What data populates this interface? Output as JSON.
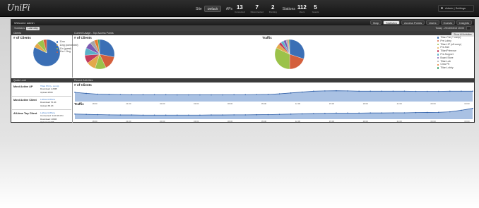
{
  "app": {
    "logo": "UniFi"
  },
  "topbar": {
    "site_label": "Site",
    "site_value": "Default",
    "counts": [
      {
        "label": "APs",
        "value": "13",
        "sub": "Connected"
      },
      {
        "label": "",
        "value": "7",
        "sub": "Disconnected"
      },
      {
        "label": "",
        "value": "2",
        "sub": "Pending"
      },
      {
        "label": "Stations",
        "value": "112",
        "sub": "Users"
      },
      {
        "label": "",
        "value": "5",
        "sub": "Guests"
      }
    ],
    "admin": "Admin | Settings"
  },
  "panel": {
    "title": "Welcome admin",
    "tabs": [
      {
        "label": "Map",
        "active": false
      },
      {
        "label": "Statistics",
        "active": true
      },
      {
        "label": "Access Points",
        "active": false
      },
      {
        "label": "Users",
        "active": false
      },
      {
        "label": "Guests",
        "active": false
      },
      {
        "label": "Insights",
        "active": false
      }
    ],
    "filter_label": "Statistics",
    "filter_value": "Last day",
    "date_value": "Today - 2013/03/13 15:00"
  },
  "sections": {
    "clients": "Clients",
    "current_usage": "Current Usage - Top Access Points",
    "quick_look": "Quick Look",
    "recent_activities": "Recent Activities",
    "show_all": "Show All Activities"
  },
  "clients_chart": {
    "title": "# of Clients",
    "legend": [
      {
        "label": "11na",
        "color": "#3b6fb5"
      },
      {
        "label": "11ng (connected)",
        "color": "#e3a94a"
      },
      {
        "label": "11n (guest)",
        "color": "#9bc24a"
      },
      {
        "label": "11a / 11ng",
        "color": "#d45f3c"
      }
    ]
  },
  "usage_clients_chart": {
    "title": "# of Clients"
  },
  "usage_traffic_chart": {
    "title": "Traffic",
    "legend": [
      {
        "label": "Tilian Phil (+ comp)",
        "color": "#3b6fb5"
      },
      {
        "label": "Pre Lobby",
        "color": "#d45f3c"
      },
      {
        "label": "Tilian HP (off comp)",
        "color": "#9bc24a"
      },
      {
        "label": "Pre-Hall",
        "color": "#e3a94a"
      },
      {
        "label": "Tilian/Primrose",
        "color": "#c23b5c"
      },
      {
        "label": "Pre-Support",
        "color": "#5ab0c8"
      },
      {
        "label": "Board Store",
        "color": "#7c5ab2"
      },
      {
        "label": "Tilian Lab",
        "color": "#a6a6a6"
      },
      {
        "label": "Crew Pit",
        "color": "#e87d2a"
      },
      {
        "label": "Tilian Lobby",
        "color": "#3aa36b"
      }
    ]
  },
  "quick_look": [
    {
      "title": "Most Active AP",
      "link": "Tilian Phil (+ comp)",
      "lines": [
        "Download 1.2MB",
        "Upload 250K"
      ]
    },
    {
      "title": "Most Active Client",
      "link": "Loibas-Griffone",
      "lines": [
        "Download 76.4K",
        "Upload 38.2K"
      ]
    },
    {
      "title": "All-time Top Client",
      "link": "Loibas-Griffone",
      "lines": [
        "Connected: 14d 03:47m",
        "Download: 406M",
        "Upload: 8.47T"
      ]
    }
  ],
  "timeseries": {
    "clients_title": "# of Clients",
    "traffic_title": "Traffic",
    "ticks": [
      "18:00",
      "21:00",
      "00:00",
      "03:00",
      "06:00",
      "09:00",
      "12:00",
      "15:00",
      "18:00",
      "21:00",
      "00:00",
      "03:00"
    ]
  },
  "chart_data": [
    {
      "type": "pie",
      "title": "# of Clients",
      "categories": [
        "11na",
        "11ng (connected)",
        "11n (guest)",
        "11a / 11ng"
      ],
      "values": [
        82,
        6,
        8,
        4
      ]
    },
    {
      "type": "pie",
      "title": "# of Clients",
      "categories": [
        "Tilian Phil (+ comp)",
        "Pre Lobby",
        "Tilian HP (off comp)",
        "Pre-Hall",
        "Tilian/Primrose",
        "Pre-Support",
        "Board Store",
        "Tilian Lab",
        "Crew Pit",
        "Tilian Lobby"
      ],
      "values": [
        28,
        15,
        12,
        10,
        9,
        8,
        7,
        5,
        4,
        2
      ]
    },
    {
      "type": "pie",
      "title": "Traffic",
      "categories": [
        "Tilian Phil (+ comp)",
        "Pre Lobby",
        "Tilian HP (off comp)",
        "Pre-Hall",
        "Tilian/Primrose",
        "Pre-Support",
        "Board Store",
        "Tilian Lab",
        "Crew Pit",
        "Tilian Lobby"
      ],
      "values": [
        30,
        20,
        32,
        5,
        3,
        3,
        3,
        2,
        1,
        1
      ]
    },
    {
      "type": "area",
      "title": "# of Clients",
      "x": [
        "18:00",
        "19:00",
        "20:00",
        "21:00",
        "22:00",
        "23:00",
        "00:00",
        "01:00",
        "02:00",
        "03:00",
        "04:00",
        "05:00",
        "06:00",
        "07:00",
        "08:00",
        "09:00",
        "10:00",
        "11:00",
        "12:00",
        "13:00",
        "14:00",
        "15:00",
        "16:00",
        "17:00",
        "18:00",
        "19:00",
        "20:00",
        "21:00",
        "22:00",
        "23:00",
        "00:00",
        "01:00",
        "02:00",
        "03:00",
        "04:00",
        "05:00"
      ],
      "values": [
        62,
        55,
        50,
        48,
        47,
        46,
        46,
        46,
        46,
        45,
        45,
        45,
        45,
        45,
        46,
        46,
        47,
        48,
        52,
        58,
        64,
        70,
        72,
        73,
        72,
        70,
        70,
        70,
        70,
        70,
        69,
        69,
        69,
        70,
        70,
        70
      ]
    },
    {
      "type": "area",
      "title": "Traffic",
      "x": [
        "18:00",
        "19:00",
        "20:00",
        "21:00",
        "22:00",
        "23:00",
        "00:00",
        "01:00",
        "02:00",
        "03:00",
        "04:00",
        "05:00",
        "06:00",
        "07:00",
        "08:00",
        "09:00",
        "10:00",
        "11:00",
        "12:00",
        "13:00",
        "14:00",
        "15:00",
        "16:00",
        "17:00",
        "18:00",
        "19:00",
        "20:00",
        "21:00",
        "22:00",
        "23:00",
        "00:00",
        "01:00",
        "02:00",
        "03:00",
        "04:00",
        "05:00"
      ],
      "values": [
        40,
        38,
        36,
        34,
        33,
        33,
        32,
        32,
        32,
        32,
        32,
        32,
        33,
        33,
        34,
        34,
        35,
        36,
        38,
        40,
        42,
        44,
        46,
        48,
        48,
        48,
        49,
        49,
        50,
        50,
        52,
        53,
        54,
        58,
        70,
        85
      ]
    }
  ]
}
